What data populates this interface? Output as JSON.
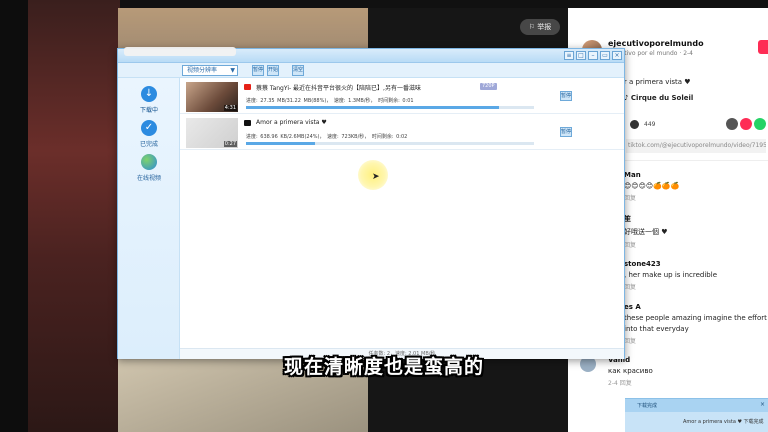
{
  "tiktok": {
    "report_label": "举报",
    "author": {
      "name": "ejecutivoporelmundo",
      "sub": "Ejecutivo por el mundo",
      "days": "2-4"
    },
    "caption": "Amor a primera vista ♥",
    "tag": "Cirque du Soleil",
    "stat_count": "449",
    "link": "tiktok.com/@ejecutivoporelmundo/video/71959...",
    "comments": [
      {
        "name": "Man",
        "text": "😊😊😊😊🍊🍊🍊",
        "meta": "回复"
      },
      {
        "name": "笙",
        "text": "好哦送一個 ♥",
        "meta": "回复"
      },
      {
        "name": "stone423",
        "text": ", her make up is incredible",
        "meta": "回复"
      },
      {
        "name": "es A",
        "text": "these people amazing imagine the effort th",
        "text2": "into that everyday",
        "meta": "回复"
      },
      {
        "name": "Vahid",
        "text": "как красиво",
        "meta": "2-4    回复"
      }
    ]
  },
  "downloader": {
    "toolbar": {
      "select_label": "视频分辨率",
      "buttons": [
        "暂停",
        "开始",
        "清空"
      ]
    },
    "sidebar": [
      {
        "label": "下载中",
        "icon": "download-icon",
        "active": true
      },
      {
        "label": "已完成",
        "icon": "check-icon",
        "active": false
      },
      {
        "label": "在线视频",
        "icon": "globe-icon",
        "active": false
      }
    ],
    "rows": [
      {
        "source_icon": "youtube-icon",
        "title": "蔡蔡 TangYi- 最近在抖音平台很火的【陪陪已】,另有一番滋味",
        "badge": "720P",
        "duration": "4:31",
        "stats": "进度: 27.35 MB/31.22 MB(88%)，  速度: 1.3MB/秒，  时间剩余: 0:01",
        "progress": 88,
        "action": "暂停"
      },
      {
        "source_icon": "tiktok-icon",
        "title": "Amor a primera vista ♥",
        "badge": "",
        "duration": "0:27",
        "stats": "进度: 638.96 KB/2.6MB(24%)，  速度: 723KB/秒，  时间剩余: 0:02",
        "progress": 24,
        "action": "暂停"
      }
    ],
    "status": "任务数: 2，速度: 2.01 MB/秒"
  },
  "subtitle": "现在清晰度也是蛮高的",
  "popup": {
    "title": "下载完成",
    "text": "Amor a primera vista ♥  下载完成"
  },
  "colors": {
    "accent": "#5aa8e6",
    "tiktok_red": "#fe2c55"
  }
}
